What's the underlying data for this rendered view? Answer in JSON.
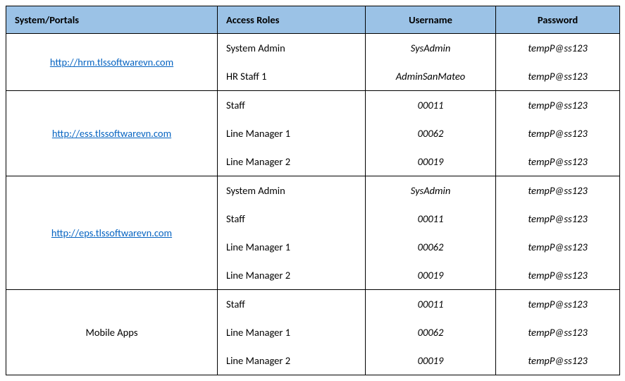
{
  "headers": {
    "system": "System/Portals",
    "roles": "Access Roles",
    "username": "Username",
    "password": "Password"
  },
  "groups": [
    {
      "system": "http://hrm.tlssoftwarevn.com",
      "isLink": true,
      "rows": [
        {
          "role": "System Admin",
          "user": "SysAdmin",
          "pass": "tempP@ss123"
        },
        {
          "role": "HR Staff 1",
          "user": "AdminSanMateo",
          "pass": "tempP@ss123"
        }
      ]
    },
    {
      "system": "http://ess.tlssoftwarevn.com",
      "isLink": true,
      "rows": [
        {
          "role": "Staff",
          "user": "00011",
          "pass": "tempP@ss123"
        },
        {
          "role": "Line Manager 1",
          "user": "00062",
          "pass": "tempP@ss123"
        },
        {
          "role": "Line Manager 2",
          "user": "00019",
          "pass": "tempP@ss123"
        }
      ]
    },
    {
      "system": "http://eps.tlssoftwarevn.com",
      "isLink": true,
      "rows": [
        {
          "role": "System Admin",
          "user": "SysAdmin",
          "pass": "tempP@ss123"
        },
        {
          "role": "Staff",
          "user": "00011",
          "pass": "tempP@ss123"
        },
        {
          "role": "Line Manager 1",
          "user": "00062",
          "pass": "tempP@ss123"
        },
        {
          "role": "Line Manager 2",
          "user": "00019",
          "pass": "tempP@ss123"
        }
      ]
    },
    {
      "system": "Mobile Apps",
      "isLink": false,
      "rows": [
        {
          "role": "Staff",
          "user": "00011",
          "pass": "tempP@ss123"
        },
        {
          "role": "Line Manager 1",
          "user": "00062",
          "pass": "tempP@ss123"
        },
        {
          "role": "Line Manager 2",
          "user": "00019",
          "pass": "tempP@ss123"
        }
      ]
    }
  ]
}
